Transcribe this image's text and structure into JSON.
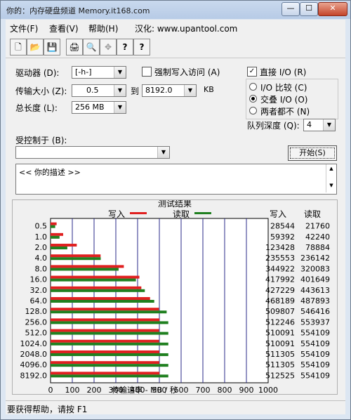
{
  "window": {
    "title": "你的：内存硬盘频道 Memory.it168.com",
    "min_label": "—",
    "max_label": "☐",
    "close_label": "✕"
  },
  "menu": [
    {
      "label": "文件(F)"
    },
    {
      "label": "查看(V)"
    },
    {
      "label": "帮助(H)"
    },
    {
      "label": "汉化: www.upantool.com"
    }
  ],
  "toolbar": [
    {
      "icon": "new-icon",
      "glyph": "🗋"
    },
    {
      "icon": "open-icon",
      "glyph": "📂"
    },
    {
      "icon": "save-icon",
      "glyph": "💾"
    },
    {
      "icon": "print-icon",
      "glyph": "🖨"
    },
    {
      "icon": "print-preview-icon",
      "glyph": "🔍"
    },
    {
      "icon": "move-icon",
      "glyph": "✥"
    },
    {
      "icon": "help-icon",
      "glyph": "?"
    },
    {
      "icon": "context-help-icon",
      "glyph": "?"
    }
  ],
  "form": {
    "drive_label": "驱动器 (D):",
    "drive_value": "[-h-]",
    "force_write_label": "强制写入访问 (A)",
    "transfer_size_label": "传输大小 (Z):",
    "transfer_from": "0.5",
    "to_label": "到",
    "transfer_to": "8192.0",
    "kb_label": "KB",
    "total_length_label": "总长度 (L):",
    "total_length_value": "256 MB",
    "direct_io_label": "直接 I/O (R)",
    "io_compare_label": "I/O 比较 (C)",
    "overlapped_io_label": "交叠 I/O (O)",
    "neither_label": "两者都不 (N)",
    "queue_depth_label": "队列深度 (Q):",
    "queue_depth_value": "4",
    "controlled_by_label": "受控制于 (B):",
    "controlled_by_value": "",
    "start_button": "开始(S)",
    "description": "<<   你的描述   >>"
  },
  "results": {
    "group_title": "测试结果",
    "write_legend": "写入",
    "read_legend": "读取",
    "write_header": "写入",
    "read_header": "读取",
    "write_color": "#e02020",
    "read_color": "#208020",
    "rows": [
      {
        "size": "0.5",
        "write": "28544",
        "read": "21760"
      },
      {
        "size": "1.0",
        "write": "59392",
        "read": "42240"
      },
      {
        "size": "2.0",
        "write": "123428",
        "read": "78884"
      },
      {
        "size": "4.0",
        "write": "235553",
        "read": "236142"
      },
      {
        "size": "8.0",
        "write": "344922",
        "read": "320083"
      },
      {
        "size": "16.0",
        "write": "417992",
        "read": "401649"
      },
      {
        "size": "32.0",
        "write": "427229",
        "read": "443613"
      },
      {
        "size": "64.0",
        "write": "468189",
        "read": "487893"
      },
      {
        "size": "128.0",
        "write": "509807",
        "read": "546416"
      },
      {
        "size": "256.0",
        "write": "512246",
        "read": "553937"
      },
      {
        "size": "512.0",
        "write": "510091",
        "read": "554109"
      },
      {
        "size": "1024.0",
        "write": "510091",
        "read": "554109"
      },
      {
        "size": "2048.0",
        "write": "511305",
        "read": "554109"
      },
      {
        "size": "4096.0",
        "write": "511305",
        "read": "554109"
      },
      {
        "size": "8192.0",
        "write": "512525",
        "read": "554109"
      }
    ]
  },
  "chart_data": {
    "type": "bar",
    "categories": [
      "0.5",
      "1.0",
      "2.0",
      "4.0",
      "8.0",
      "16.0",
      "32.0",
      "64.0",
      "128.0",
      "256.0",
      "512.0",
      "1024.0",
      "2048.0",
      "4096.0",
      "8192.0"
    ],
    "series": [
      {
        "name": "写入",
        "values": [
          28544,
          59392,
          123428,
          235553,
          344922,
          417992,
          427229,
          468189,
          509807,
          512246,
          510091,
          510091,
          511305,
          511305,
          512525
        ]
      },
      {
        "name": "读取",
        "values": [
          21760,
          42240,
          78884,
          236142,
          320083,
          401649,
          443613,
          487893,
          546416,
          553937,
          554109,
          554109,
          554109,
          554109,
          554109
        ]
      }
    ],
    "xlabel": "传输速率 - MB / 秒",
    "xlim": [
      0,
      1000
    ],
    "xticks": [
      "0",
      "100",
      "200",
      "300",
      "400",
      "500",
      "600",
      "700",
      "800",
      "900",
      "1000"
    ],
    "unit_divisor": 1024,
    "grid": true
  },
  "status": {
    "text": "要获得帮助，请按 F1"
  }
}
